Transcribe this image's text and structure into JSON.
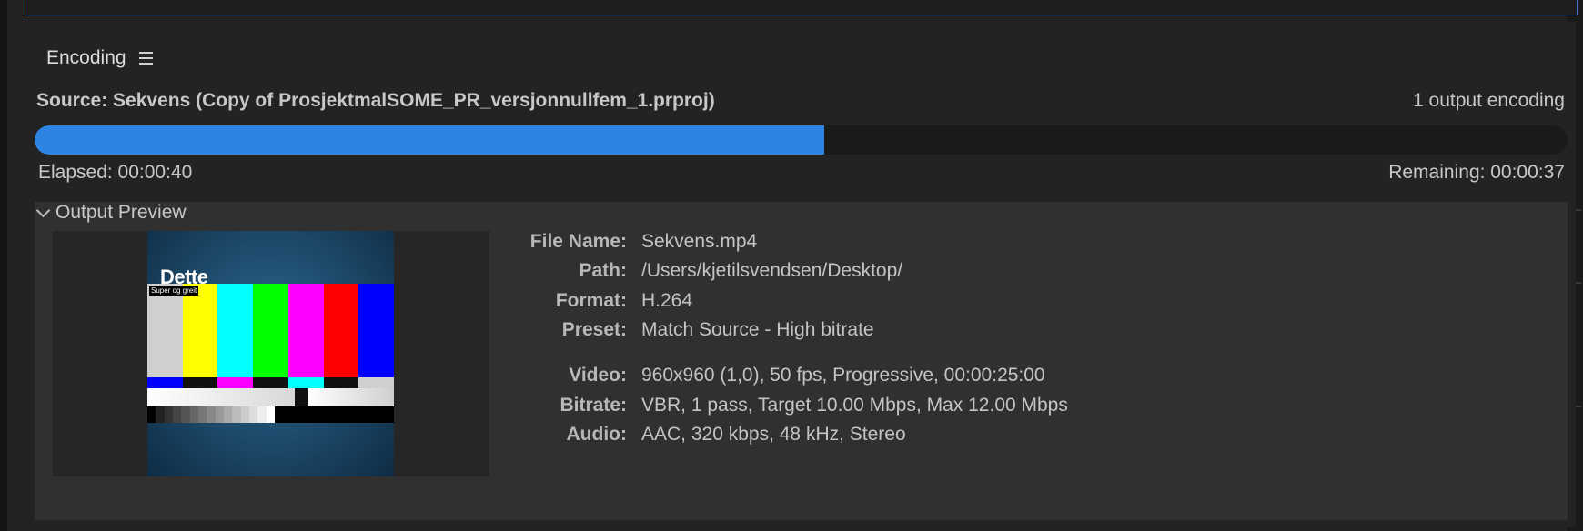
{
  "panel": {
    "title": "Encoding"
  },
  "source": {
    "text": "Source: Sekvens (Copy of ProsjektmalSOME_PR_versjonnullfem_1.prproj)",
    "outputs": "1 output encoding"
  },
  "progress": {
    "fraction": 0.515,
    "elapsed": "Elapsed: 00:00:40",
    "remaining": "Remaining: 00:00:37"
  },
  "preview": {
    "label": "Output Preview",
    "thumbnail_title": "Dette",
    "thumbnail_caption": "Super og greit",
    "bar_colors": [
      "#cfcfcf",
      "#ffff00",
      "#00ffff",
      "#00ff00",
      "#ff00ff",
      "#ff0000",
      "#0000ff"
    ],
    "sub_bar_colors": [
      "#0000ff",
      "#111111",
      "#ff00ff",
      "#111111",
      "#00ffff",
      "#111111",
      "#cfcfcf"
    ],
    "step_colors": [
      "#000000",
      "#222222",
      "#333333",
      "#444444",
      "#555555",
      "#666666",
      "#777777",
      "#888888",
      "#999999",
      "#aaaaaa",
      "#bbbbbb",
      "#cccccc",
      "#dddddd",
      "#eeeeee",
      "#ffffff"
    ]
  },
  "file_info": {
    "file_name_label": "File Name:",
    "file_name": "Sekvens.mp4",
    "path_label": "Path:",
    "path": "/Users/kjetilsvendsen/Desktop/",
    "format_label": "Format:",
    "format": "H.264",
    "preset_label": "Preset:",
    "preset": "Match Source - High bitrate",
    "video_label": "Video:",
    "video": "960x960 (1,0), 50 fps, Progressive, 00:00:25:00",
    "bitrate_label": "Bitrate:",
    "bitrate": "VBR, 1 pass, Target 10.00 Mbps, Max 12.00 Mbps",
    "audio_label": "Audio:",
    "audio": "AAC, 320 kbps, 48 kHz, Stereo"
  }
}
